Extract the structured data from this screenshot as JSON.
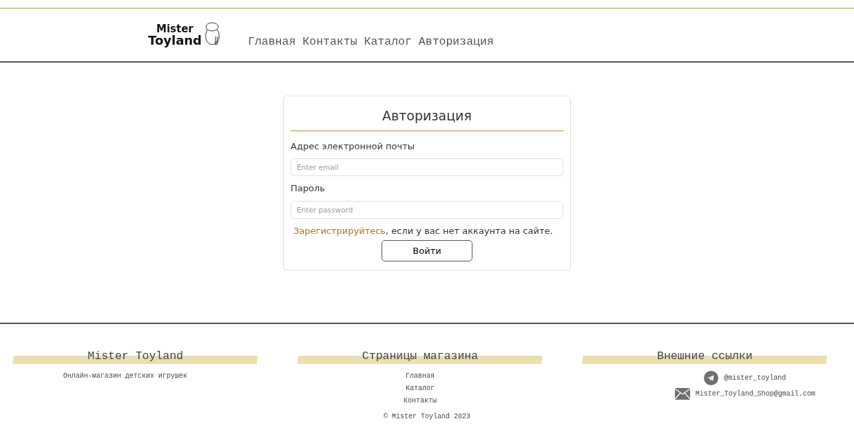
{
  "header": {
    "logo_lines": [
      "Mister",
      "Toyland"
    ],
    "nav": [
      "Главная",
      "Контакты",
      "Каталог",
      "Авторизация"
    ]
  },
  "login_card": {
    "title": "Авторизация",
    "email_label": "Адрес электронной почты",
    "email_placeholder": "Enter email",
    "password_label": "Пароль",
    "password_placeholder": "Enter password",
    "register_link": "Зарегистрируйтесь",
    "register_text": ", если у вас нет аккаунта на сайте.",
    "submit": "Войти"
  },
  "footer": {
    "columns": [
      {
        "kind": "about",
        "title": "Mister Toyland",
        "text": "Онлайн-магазин детских игрушек"
      },
      {
        "kind": "links",
        "title": "Страницы магазина",
        "links": [
          "Главная",
          "Каталог",
          "Контакты"
        ]
      },
      {
        "kind": "contacts",
        "title": "Внешние ссылки",
        "contacts": [
          {
            "kind": "telegram",
            "text": "@mister_toyland"
          },
          {
            "kind": "email",
            "text": "Mister_Toyland_Shop@gmail.com"
          }
        ]
      }
    ],
    "copyright": "© Mister Toyland 2023"
  }
}
